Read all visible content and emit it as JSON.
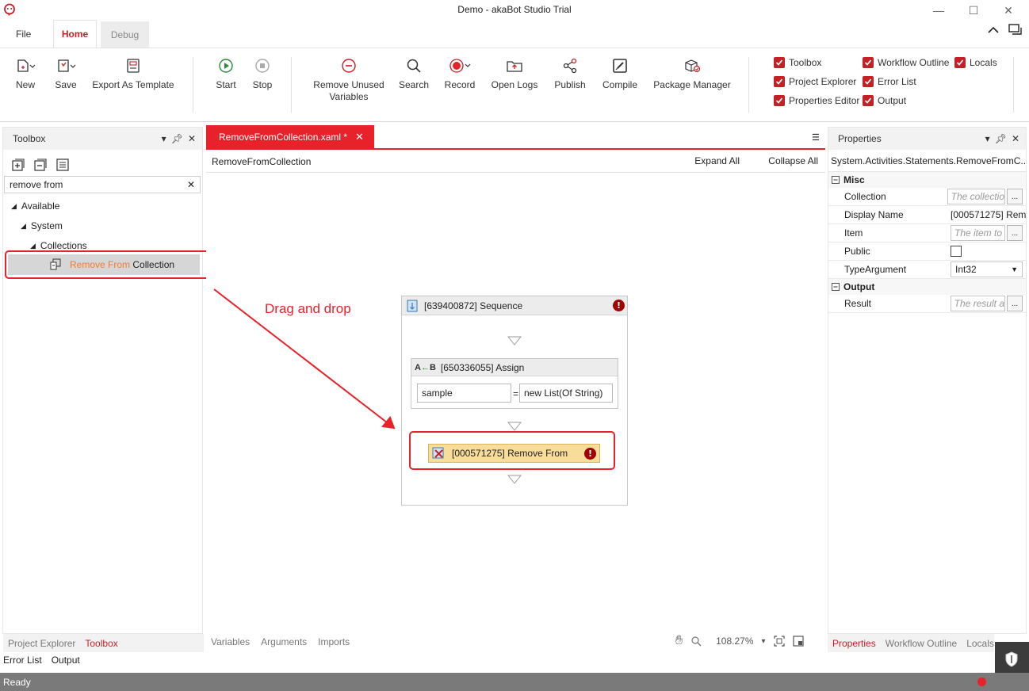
{
  "window": {
    "title": "Demo - akaBot Studio Trial",
    "minimize_glyph": "—",
    "maximize_glyph": "☐",
    "close_glyph": "✕"
  },
  "ribbon_tabs": [
    {
      "label": "File"
    },
    {
      "label": "Home",
      "active": true
    },
    {
      "label": "Debug"
    }
  ],
  "ribbon": {
    "buttons": [
      {
        "label": "New",
        "icon": "new-file-icon"
      },
      {
        "label": "Save",
        "icon": "save-icon"
      },
      {
        "label": "Export As Template",
        "icon": "export-template-icon"
      },
      {
        "label": "Start",
        "icon": "play-icon"
      },
      {
        "label": "Stop",
        "icon": "stop-icon"
      },
      {
        "label": "Remove Unused",
        "label2": "Variables",
        "icon": "remove-icon"
      },
      {
        "label": "Search",
        "icon": "search-icon"
      },
      {
        "label": "Record",
        "icon": "record-icon"
      },
      {
        "label": "Open Logs",
        "icon": "folder-icon"
      },
      {
        "label": "Publish",
        "icon": "share-icon"
      },
      {
        "label": "Compile",
        "icon": "compile-icon"
      },
      {
        "label": "Package Manager",
        "icon": "package-icon"
      }
    ],
    "view_toggles": [
      {
        "label": "Toolbox",
        "checked": true
      },
      {
        "label": "Project Explorer",
        "checked": true
      },
      {
        "label": "Properties Editor",
        "checked": true
      },
      {
        "label": "Workflow Outline",
        "checked": true
      },
      {
        "label": "Error List",
        "checked": true
      },
      {
        "label": "Output",
        "checked": true
      },
      {
        "label": "Locals",
        "checked": true
      }
    ]
  },
  "toolbox": {
    "title": "Toolbox",
    "search_value": "remove from",
    "tree": {
      "root": "Available",
      "level1": "System",
      "level2": "Collections",
      "item_highlight": "Remove From",
      "item_rest": " Collection"
    },
    "bottom_tabs": [
      "Project Explorer",
      "Toolbox"
    ]
  },
  "document": {
    "tab_label": "RemoveFromCollection.xaml *",
    "breadcrumb": "RemoveFromCollection",
    "expand_all": "Expand All",
    "collapse_all": "Collapse All"
  },
  "workflow": {
    "sequence_title": "[639400872] Sequence",
    "assign_title": "[650336055] Assign",
    "assign_to": "sample",
    "assign_equals": "=",
    "assign_value": "new List(Of String)",
    "remove_title": "[000571275] Remove From",
    "annotation": "Drag and drop",
    "annotation_color": "#e8222a"
  },
  "designer_footer": {
    "tabs": [
      "Variables",
      "Arguments",
      "Imports"
    ],
    "zoom": "108.27%"
  },
  "properties": {
    "title": "Properties",
    "type_name": "System.Activities.Statements.RemoveFromC...",
    "categories": [
      {
        "name": "Misc",
        "rows": [
          {
            "name": "Collection",
            "placeholder": "The collectio",
            "kind": "expr"
          },
          {
            "name": "Display Name",
            "value": "[000571275] Rem",
            "kind": "text"
          },
          {
            "name": "Item",
            "placeholder": "The item to",
            "kind": "expr"
          },
          {
            "name": "Public",
            "kind": "checkbox"
          },
          {
            "name": "TypeArgument",
            "value": "Int32",
            "kind": "select"
          }
        ]
      },
      {
        "name": "Output",
        "rows": [
          {
            "name": "Result",
            "placeholder": "The result a",
            "kind": "expr"
          }
        ]
      }
    ],
    "bottom_tabs": [
      "Properties",
      "Workflow Outline",
      "Locals"
    ]
  },
  "output_tabs": [
    "Error List",
    "Output"
  ],
  "status": {
    "text": "Ready"
  },
  "colors": {
    "brand_red": "#c62026",
    "accent_red": "#e8222a"
  }
}
